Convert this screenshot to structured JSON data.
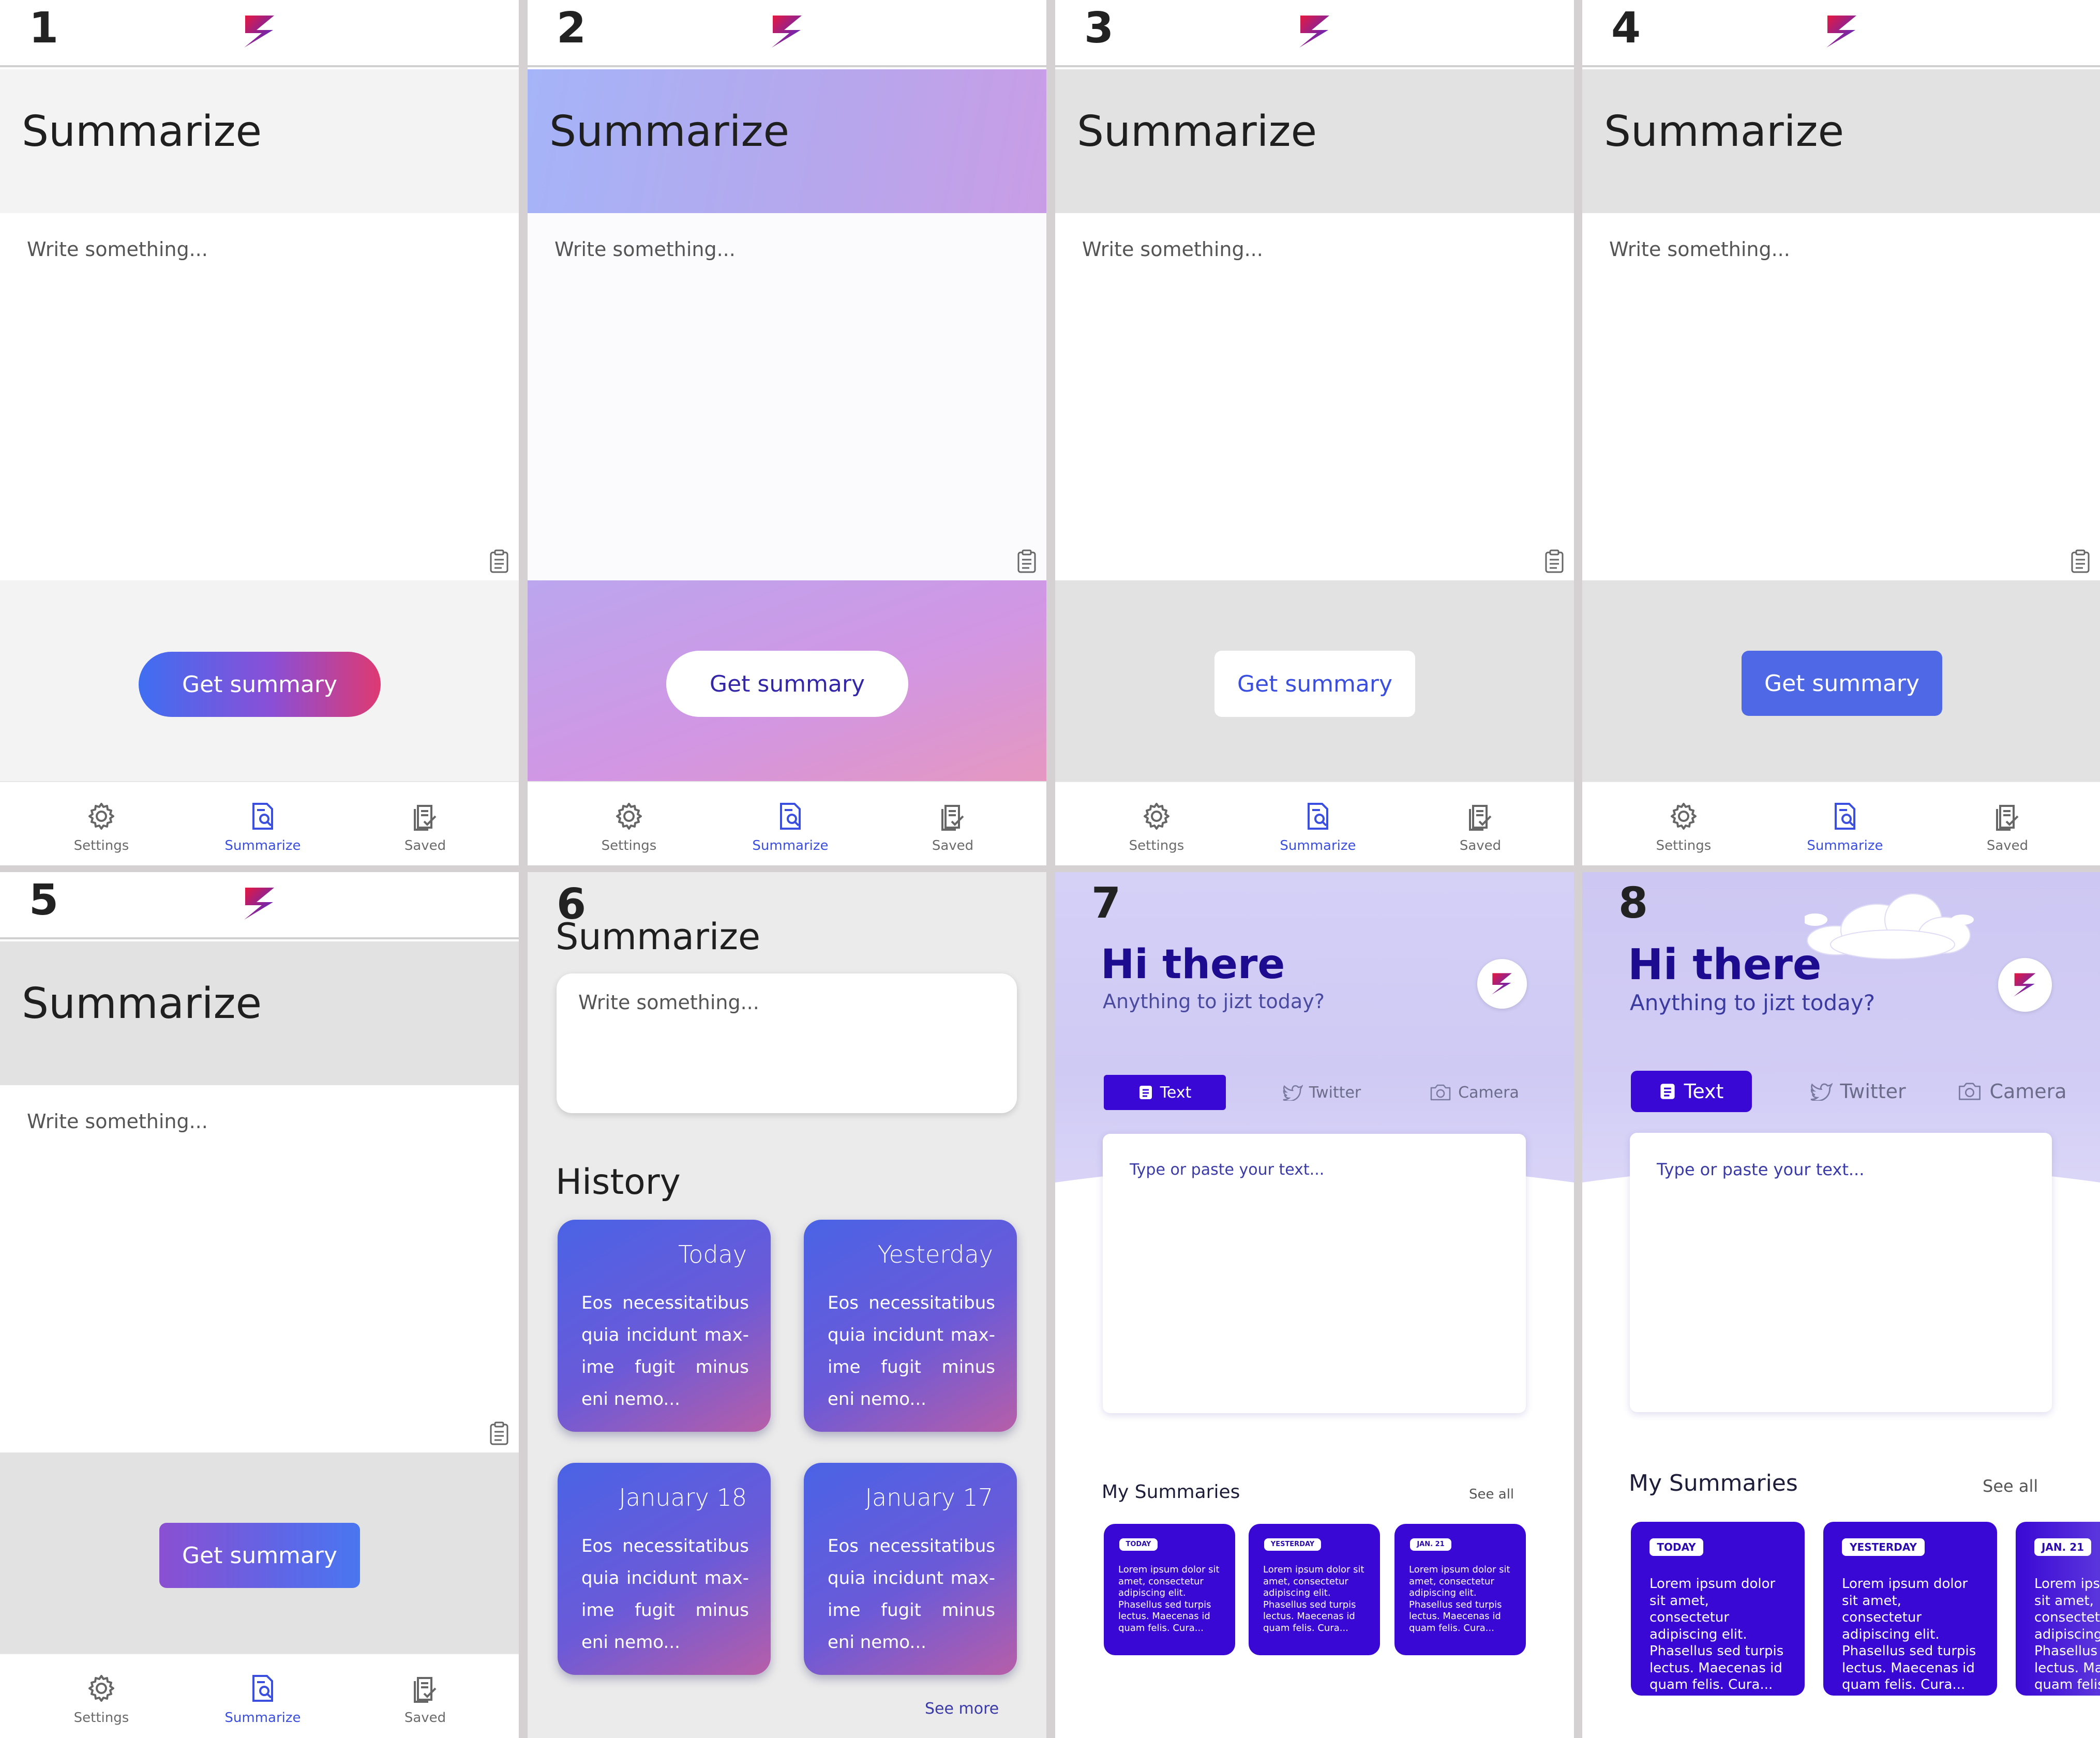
{
  "app": {
    "panel_numbers": [
      "1",
      "2",
      "3",
      "4",
      "5",
      "6",
      "7",
      "8"
    ],
    "title": "Summarize",
    "placeholder": "Write something...",
    "button_label": "Get summary",
    "nav": {
      "settings": "Settings",
      "summarize": "Summarize",
      "saved": "Saved"
    }
  },
  "history": {
    "heading": "History",
    "see_more": "See more",
    "cards": [
      {
        "date": "Today",
        "text": "Eos necessitatibus quia incidunt max-ime fugit minus eni nemo..."
      },
      {
        "date": "Yesterday",
        "text": "Eos necessitatibus quia incidunt max-ime fugit minus eni nemo..."
      },
      {
        "date": "January 18",
        "text": "Eos necessitatibus quia incidunt max-ime fugit minus eni nemo..."
      },
      {
        "date": "January 17",
        "text": "Eos necessitatibus quia incidunt max-ime fugit minus eni nemo..."
      }
    ]
  },
  "home": {
    "greeting": "Hi there",
    "subtitle": "Anything to jizt today?",
    "tabs": [
      "Text",
      "Twitter",
      "Camera"
    ],
    "input_placeholder": "Type or paste your text...",
    "my_summaries": "My Summaries",
    "see_all": "See all",
    "cards": [
      {
        "badge": "TODAY",
        "text": "Lorem ipsum dolor sit amet, consectetur adipiscing elit. Phasellus sed turpis lectus. Maecenas id quam felis. Cura..."
      },
      {
        "badge": "YESTERDAY",
        "text": "Lorem ipsum dolor sit amet, consectetur adipiscing elit. Phasellus sed turpis lectus. Maecenas id quam felis. Cura..."
      },
      {
        "badge": "JAN. 21",
        "text": "Lorem ipsum dolor sit amet, consectetur adipiscing elit. Phasellus sed turpis lectus. Maecenas id quam felis. Cura..."
      }
    ]
  },
  "colors": {
    "accent_blue": "#3a4fe0",
    "summary_card": "#3a08d4",
    "logo_red": "#e8183c",
    "logo_blue": "#3d2de0"
  }
}
